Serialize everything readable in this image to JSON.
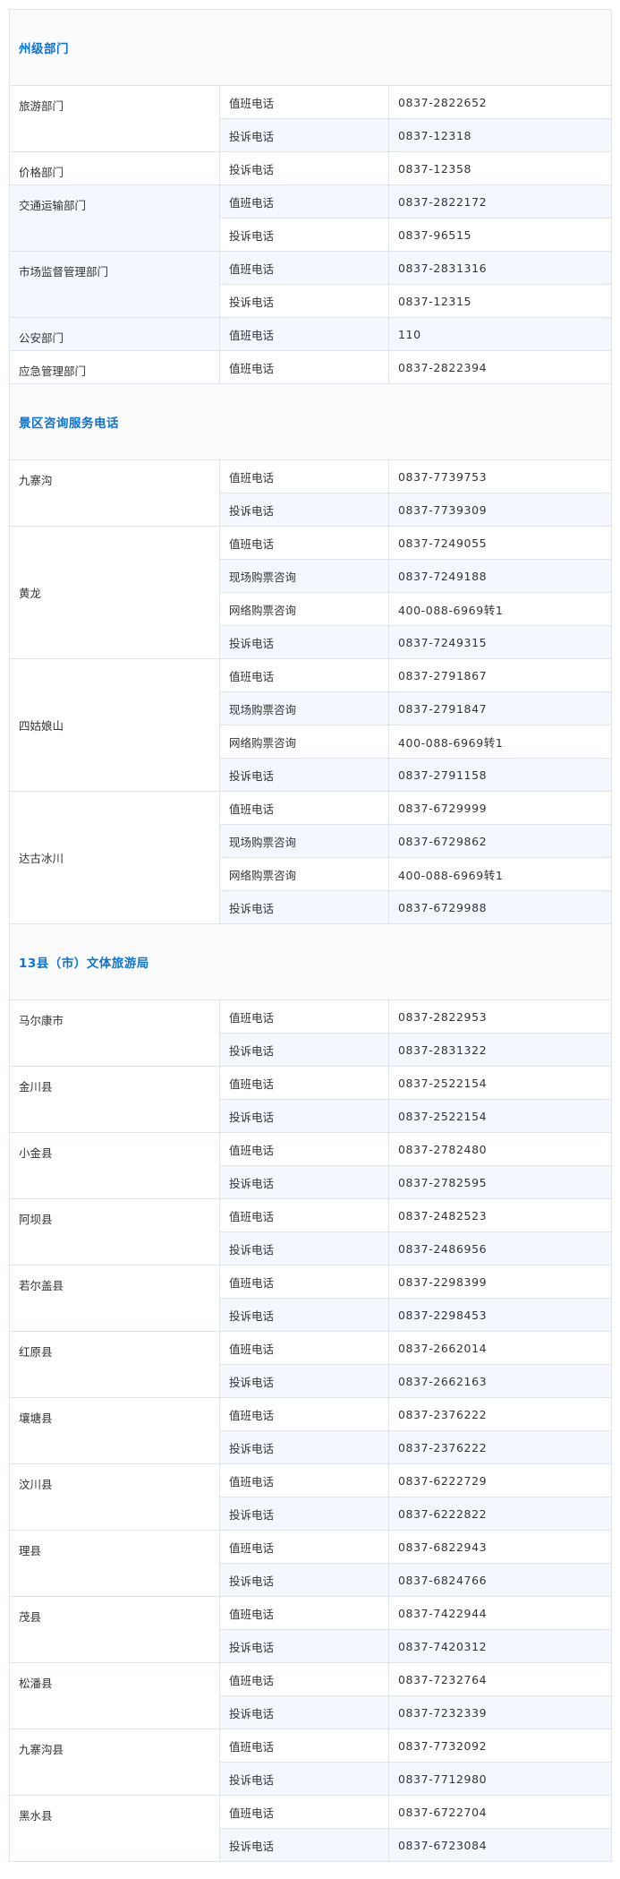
{
  "sections": [
    {
      "title": "州级部门",
      "groups": [
        {
          "name": "旅游部门",
          "rows": [
            [
              "值班电话",
              "0837-2822652"
            ],
            [
              "投诉电话",
              "0837-12318"
            ]
          ]
        },
        {
          "name": "价格部门",
          "rows": [
            [
              "投诉电话",
              "0837-12358"
            ]
          ]
        },
        {
          "name": "交通运输部门",
          "rows": [
            [
              "值班电话",
              "0837-2822172"
            ],
            [
              "投诉电话",
              "0837-96515"
            ]
          ]
        },
        {
          "name": "市场监督管理部门",
          "rows": [
            [
              "值班电话",
              "0837-2831316"
            ],
            [
              "投诉电话",
              "0837-12315"
            ]
          ]
        },
        {
          "name": "公安部门",
          "rows": [
            [
              "值班电话",
              "110"
            ]
          ]
        },
        {
          "name": "应急管理部门",
          "rows": [
            [
              "值班电话",
              "0837-2822394"
            ]
          ]
        }
      ]
    },
    {
      "title": "景区咨询服务电话",
      "groups": [
        {
          "name": "九寨沟",
          "rows": [
            [
              "值班电话",
              "0837-7739753"
            ],
            [
              "投诉电话",
              "0837-7739309"
            ]
          ]
        },
        {
          "name": "黄龙",
          "middle": true,
          "rows": [
            [
              "值班电话",
              "0837-7249055"
            ],
            [
              "现场购票咨询",
              "0837-7249188"
            ],
            [
              "网络购票咨询",
              "400-088-6969转1"
            ],
            [
              "投诉电话",
              "0837-7249315"
            ]
          ]
        },
        {
          "name": "四姑娘山",
          "middle": true,
          "rows": [
            [
              "值班电话",
              "0837-2791867"
            ],
            [
              "现场购票咨询",
              "0837-2791847"
            ],
            [
              "网络购票咨询",
              "400-088-6969转1"
            ],
            [
              "投诉电话",
              "0837-2791158"
            ]
          ]
        },
        {
          "name": "达古冰川",
          "middle": true,
          "rows": [
            [
              "值班电话",
              "0837-6729999"
            ],
            [
              "现场购票咨询",
              "0837-6729862"
            ],
            [
              "网络购票咨询",
              "400-088-6969转1"
            ],
            [
              "投诉电话",
              "0837-6729988"
            ]
          ]
        }
      ]
    },
    {
      "title": "13县（市）文体旅游局",
      "groups": [
        {
          "name": "马尔康市",
          "rows": [
            [
              "值班电话",
              "0837-2822953"
            ],
            [
              "投诉电话",
              "0837-2831322"
            ]
          ]
        },
        {
          "name": "金川县",
          "rows": [
            [
              "值班电话",
              "0837-2522154"
            ],
            [
              "投诉电话",
              "0837-2522154"
            ]
          ]
        },
        {
          "name": "小金县",
          "rows": [
            [
              "值班电话",
              "0837-2782480"
            ],
            [
              "投诉电话",
              "0837-2782595"
            ]
          ]
        },
        {
          "name": "阿坝县",
          "rows": [
            [
              "值班电话",
              "0837-2482523"
            ],
            [
              "投诉电话",
              "0837-2486956"
            ]
          ]
        },
        {
          "name": "若尔盖县",
          "rows": [
            [
              "值班电话",
              "0837-2298399"
            ],
            [
              "投诉电话",
              "0837-2298453"
            ]
          ]
        },
        {
          "name": "红原县",
          "rows": [
            [
              "值班电话",
              "0837-2662014"
            ],
            [
              "投诉电话",
              "0837-2662163"
            ]
          ]
        },
        {
          "name": "壤塘县",
          "rows": [
            [
              "值班电话",
              "0837-2376222"
            ],
            [
              "投诉电话",
              "0837-2376222"
            ]
          ]
        },
        {
          "name": "汶川县",
          "rows": [
            [
              "值班电话",
              "0837-6222729"
            ],
            [
              "投诉电话",
              "0837-6222822"
            ]
          ]
        },
        {
          "name": "理县",
          "rows": [
            [
              "值班电话",
              "0837-6822943"
            ],
            [
              "投诉电话",
              "0837-6824766"
            ]
          ]
        },
        {
          "name": "茂县",
          "rows": [
            [
              "值班电话",
              "0837-7422944"
            ],
            [
              "投诉电话",
              "0837-7420312"
            ]
          ]
        },
        {
          "name": "松潘县",
          "rows": [
            [
              "值班电话",
              "0837-7232764"
            ],
            [
              "投诉电话",
              "0837-7232339"
            ]
          ]
        },
        {
          "name": "九寨沟县",
          "rows": [
            [
              "值班电话",
              "0837-7732092"
            ],
            [
              "投诉电话",
              "0837-7712980"
            ]
          ]
        },
        {
          "name": "黑水县",
          "rows": [
            [
              "值班电话",
              "0837-6722704"
            ],
            [
              "投诉电话",
              "0837-6723084"
            ]
          ]
        }
      ]
    }
  ]
}
